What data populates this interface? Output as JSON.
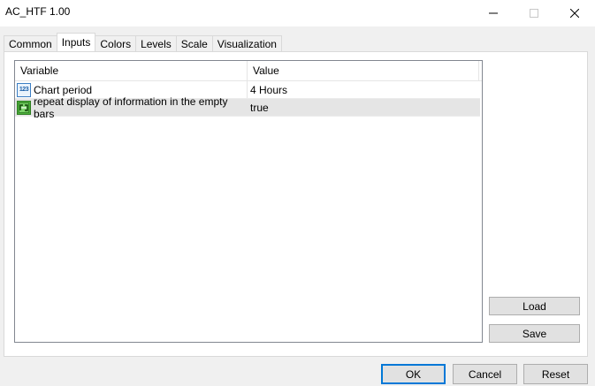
{
  "window": {
    "title": "AC_HTF 1.00"
  },
  "tabs": [
    {
      "label": "Common",
      "active": false
    },
    {
      "label": "Inputs",
      "active": true
    },
    {
      "label": "Colors",
      "active": false
    },
    {
      "label": "Levels",
      "active": false
    },
    {
      "label": "Scale",
      "active": false
    },
    {
      "label": "Visualization",
      "active": false
    }
  ],
  "grid": {
    "columns": [
      "Variable",
      "Value"
    ],
    "rows": [
      {
        "icon": "numeric-123-icon",
        "icon_text": "123",
        "variable": "Chart period",
        "value": "4 Hours"
      },
      {
        "icon": "boolean-toggle-icon",
        "variable": "repeat display of information in the empty bars",
        "value": "true"
      }
    ]
  },
  "side_buttons": {
    "load": "Load",
    "save": "Save"
  },
  "footer_buttons": {
    "ok": "OK",
    "cancel": "Cancel",
    "reset": "Reset"
  },
  "colors": {
    "focus_border": "#0078d7",
    "selected_row": "#e5e5e5"
  }
}
